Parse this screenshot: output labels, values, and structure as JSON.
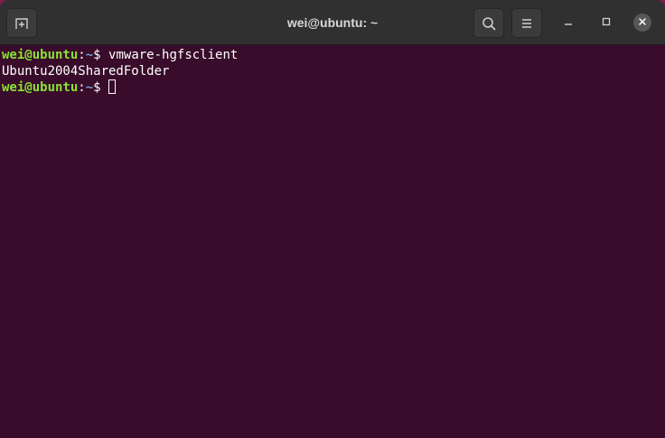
{
  "window": {
    "title": "wei@ubuntu: ~"
  },
  "header": {
    "new_tab_icon": "new-tab-icon",
    "search_icon": "search-icon",
    "menu_icon": "hamburger-menu-icon"
  },
  "window_controls": {
    "minimize_icon": "minimize-icon",
    "maximize_icon": "maximize-icon",
    "close_icon": "close-icon"
  },
  "terminal": {
    "lines": [
      {
        "user": "wei@ubuntu",
        "colon": ":",
        "path": "~",
        "prompt": "$ ",
        "command": "vmware-hgfsclient"
      },
      {
        "output": "Ubuntu2004SharedFolder"
      },
      {
        "user": "wei@ubuntu",
        "colon": ":",
        "path": "~",
        "prompt": "$ ",
        "command": ""
      }
    ]
  },
  "colors": {
    "terminal_bg": "#380c2a",
    "titlebar_bg": "#303030",
    "prompt_user": "#8ae234",
    "prompt_path": "#729fcf",
    "text": "#ffffff"
  }
}
